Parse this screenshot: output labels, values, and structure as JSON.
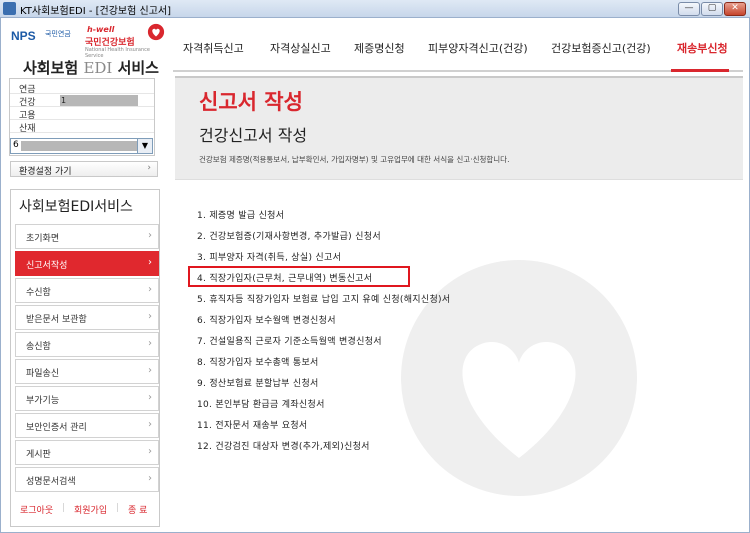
{
  "window": {
    "title": "KT사회보험EDI - [건강보험 신고서]",
    "buttons": {
      "minimize": "—",
      "maximize": "▢",
      "close": "✕"
    }
  },
  "logo": {
    "nps": "NPS",
    "nps_sub": "국민연금",
    "hwell": "h-well",
    "nhis": "국민건강보험",
    "nhis_sub": "National Health Insurance Service",
    "brand_prefix": "사회보험",
    "brand_edi": "EDI",
    "brand_suffix": "서비스"
  },
  "topnav": {
    "items": [
      {
        "label": "자격취득신고",
        "active": false
      },
      {
        "label": "자격상실신고",
        "active": false
      },
      {
        "label": "제증명신청",
        "active": false
      },
      {
        "label": "피부양자격신고(건강)",
        "active": false
      },
      {
        "label": "건강보험증신고(건강)",
        "active": false
      },
      {
        "label": "재송부신청",
        "active": true
      }
    ]
  },
  "insurance": {
    "rows": [
      {
        "label": "연금",
        "value": ""
      },
      {
        "label": "건강",
        "value": "1"
      },
      {
        "label": "고용",
        "value": ""
      },
      {
        "label": "산재",
        "value": ""
      }
    ],
    "company_select_value": "6",
    "env_button": "환경설정 가기"
  },
  "sidemenu": {
    "title": "사회보험EDI서비스",
    "items": [
      {
        "label": "초기화면",
        "active": false
      },
      {
        "label": "신고서작성",
        "active": true
      },
      {
        "label": "수신함",
        "active": false
      },
      {
        "label": "받은문서 보관함",
        "active": false
      },
      {
        "label": "송신함",
        "active": false
      },
      {
        "label": "파일송신",
        "active": false
      },
      {
        "label": "부가기능",
        "active": false
      },
      {
        "label": "보안인증서 관리",
        "active": false
      },
      {
        "label": "게시판",
        "active": false
      },
      {
        "label": "성명문서검색",
        "active": false
      }
    ],
    "footer": {
      "logout": "로그아웃",
      "register": "회원가입",
      "exit": "종 료"
    }
  },
  "content": {
    "heading": "신고서 작성",
    "subheading_bold": "건강신고서",
    "subheading_rest": " 작성",
    "description": "건강보험 제증명(적용통보서, 납부확인서, 가입자명부) 및 고유업무에 대한 서식을 신고·신청합니다.",
    "forms": [
      "1. 제증명 발급 신청서",
      "2. 건강보험증(기재사항변경, 추가발급) 신청서",
      "3. 피부양자 자격(취득, 상실) 신고서",
      "4. 직장가입자(근무처, 근무내역) 변동신고서",
      "5. 휴직자등 직장가입자 보험료 납입 고지 유예 신청(해지신청)서",
      "6. 직장가입자 보수월액 변경신청서",
      "7. 건설일용직 근로자 기준소득월액 변경신청서",
      "8. 직장가입자 보수총액 통보서",
      "9. 정산보험료 분할납부 신청서",
      "10. 본인부담 환급금 계좌신청서",
      "11. 전자문서 재송부 요청서",
      "12. 건강검진 대상자 변경(추가,제외)신청서"
    ],
    "highlighted_index": 3
  },
  "colors": {
    "accent_red": "#d9272e",
    "brand_blue": "#1c5aa6",
    "header_gray": "#ececec"
  }
}
